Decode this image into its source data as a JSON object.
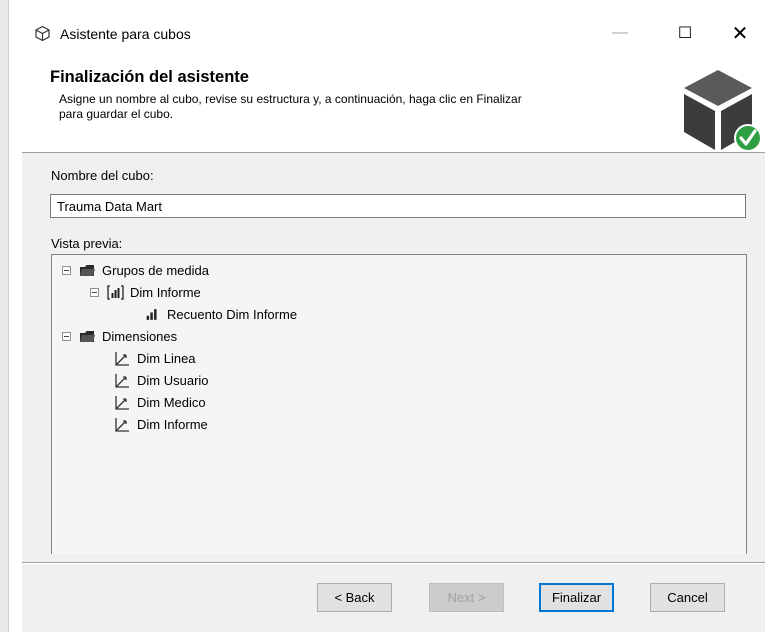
{
  "window": {
    "title": "Asistente para cubos",
    "controls": {
      "minimize": "—",
      "maximize": "☐",
      "close": "✕"
    }
  },
  "header": {
    "title": "Finalización del asistente",
    "description_line1": "Asigne un nombre al cubo, revise su estructura y, a continuación, haga clic en Finalizar",
    "description_line2": "para guardar el cubo."
  },
  "form": {
    "name_label": "Nombre del cubo:",
    "name_value": "Trauma Data Mart",
    "preview_label": "Vista previa:"
  },
  "tree": {
    "measure_groups": "Grupos de medida",
    "measure_group": "Dim Informe",
    "measure": "Recuento Dim Informe",
    "dimensions": "Dimensiones",
    "dimension_items": [
      "Dim Linea",
      "Dim Usuario",
      "Dim Medico",
      "Dim Informe"
    ]
  },
  "buttons": {
    "back": "< Back",
    "next": "Next >",
    "finish": "Finalizar",
    "cancel": "Cancel"
  },
  "icons": {
    "title": "cube-icon",
    "header": "cube-check-icon",
    "folder": "folder-icon",
    "measure_group": "measure-group-icon",
    "measure": "measure-bar-icon",
    "dimension": "dimension-axis-icon"
  },
  "colors": {
    "check_green": "#2ea043",
    "cube_dark": "#3c3c3c",
    "focus_blue": "#0078d7"
  }
}
